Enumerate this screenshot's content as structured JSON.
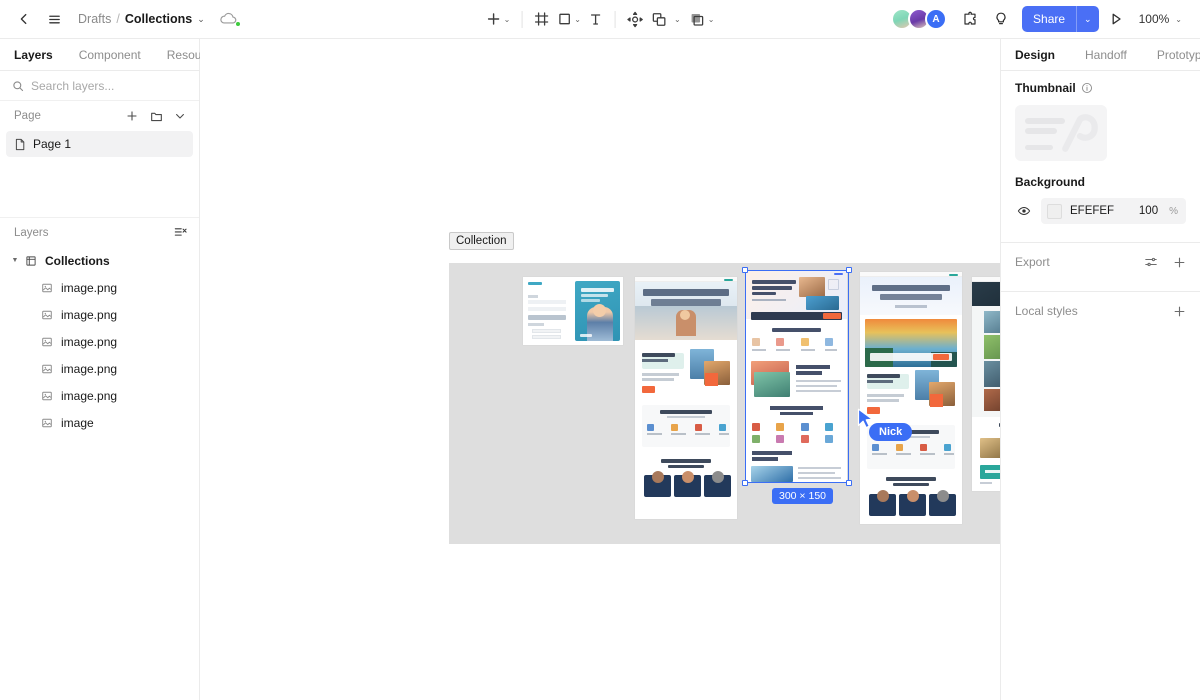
{
  "topbar": {
    "back_icon": "chevron-left-icon",
    "menu_icon": "hamburger-menu-icon",
    "breadcrumb": {
      "parent": "Drafts",
      "separator": "/",
      "current": "Collections",
      "chevron": "⌄"
    },
    "cloud_icon": "cloud-sync-icon",
    "tools": [
      {
        "name": "add-tool",
        "icon": "plus-icon",
        "has_chevron": true
      },
      {
        "name": "frame-tool",
        "icon": "frame-icon",
        "has_chevron": false
      },
      {
        "name": "shape-tool",
        "icon": "rectangle-icon",
        "has_chevron": true
      },
      {
        "name": "text-tool",
        "icon": "text-icon",
        "has_chevron": false
      },
      {
        "name": "move-tool",
        "icon": "move-icon",
        "has_chevron": false
      },
      {
        "name": "boolean-tool",
        "icon": "shapes-icon",
        "has_chevron": true
      },
      {
        "name": "mask-tool",
        "icon": "mask-icon",
        "has_chevron": true
      }
    ],
    "avatars": [
      {
        "name": "collaborator-avatar-1",
        "label": ""
      },
      {
        "name": "collaborator-avatar-2",
        "label": ""
      },
      {
        "name": "collaborator-avatar-3",
        "label": "A"
      }
    ],
    "plugin_icon": "puzzle-plugin-icon",
    "help_icon": "lightbulb-icon",
    "share_label": "Share",
    "share_chevron": "⌄",
    "present_icon": "play-present-icon",
    "zoom_level": "100%",
    "zoom_chevron": "⌄",
    "accent_color": "#4a6ff5"
  },
  "left_panel": {
    "tabs": [
      {
        "label": "Layers",
        "active": true
      },
      {
        "label": "Component",
        "active": false
      },
      {
        "label": "Resource",
        "active": false
      }
    ],
    "search": {
      "placeholder": "Search layers...",
      "value": "",
      "icon": "search-icon"
    },
    "page_section": {
      "title": "Page",
      "add_icon": "plus-icon",
      "folder_icon": "folder-icon",
      "collapse_icon": "chevron-down-icon",
      "pages": [
        {
          "label": "Page 1",
          "icon": "page-file-icon",
          "selected": true
        }
      ]
    },
    "layers_section": {
      "title": "Layers",
      "collapse_all_icon": "collapse-all-icon",
      "items": [
        {
          "label": "Collections",
          "icon": "frame-icon",
          "depth": 0,
          "expanded": true,
          "bold": true
        },
        {
          "label": "image.png",
          "icon": "image-icon",
          "depth": 1
        },
        {
          "label": "image.png",
          "icon": "image-icon",
          "depth": 1
        },
        {
          "label": "image.png",
          "icon": "image-icon",
          "depth": 1
        },
        {
          "label": "image.png",
          "icon": "image-icon",
          "depth": 1
        },
        {
          "label": "image.png",
          "icon": "image-icon",
          "depth": 1
        },
        {
          "label": "image",
          "icon": "image-icon",
          "depth": 1
        }
      ]
    }
  },
  "canvas": {
    "frame_label": "Collection",
    "frame_background": "#DEDEDE",
    "selection": {
      "size_badge": "300 × 150",
      "color": "#3b6ef5"
    },
    "cursor": {
      "name": "Nick",
      "color": "#3b6ef5"
    },
    "artboards": [
      {
        "name": "login-signup-mockup"
      },
      {
        "name": "travel-landing-page-mockup"
      },
      {
        "name": "travel-landing-page-mockup-selected"
      },
      {
        "name": "travel-landing-sunset-mockup"
      },
      {
        "name": "destination-gallery-mockup"
      }
    ]
  },
  "right_panel": {
    "tabs": [
      {
        "label": "Design",
        "active": true
      },
      {
        "label": "Handoff",
        "active": false
      },
      {
        "label": "Prototype",
        "active": false
      }
    ],
    "thumbnail": {
      "title": "Thumbnail",
      "info_icon": "info-icon"
    },
    "background": {
      "title": "Background",
      "visibility_icon": "eye-icon",
      "color_hex": "EFEFEF",
      "opacity": "100",
      "opacity_unit": "%"
    },
    "export": {
      "title": "Export",
      "settings_icon": "sliders-icon",
      "add_icon": "plus-icon"
    },
    "local_styles": {
      "title": "Local styles",
      "add_icon": "plus-icon"
    }
  }
}
